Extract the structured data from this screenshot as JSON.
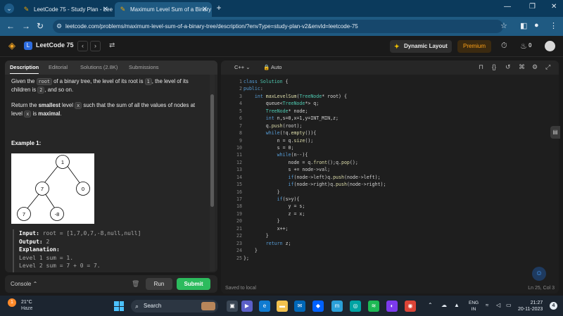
{
  "browser": {
    "tabs": [
      {
        "label": "LeetCode 75 - Study Plan - Lee"
      },
      {
        "label": "Maximum Level Sum of a Binary"
      }
    ],
    "url": "leetcode.com/problems/maximum-level-sum-of-a-binary-tree/description/?envType=study-plan-v2&envId=leetcode-75"
  },
  "header": {
    "plan_title": "LeetCode 75",
    "dynamic_layout": "Dynamic Layout",
    "premium": "Premium",
    "streak": "0"
  },
  "left_tabs": [
    "Description",
    "Editorial",
    "Solutions (2.8K)",
    "Submissions"
  ],
  "description": {
    "p1_a": "Given the ",
    "p1_code1": "root",
    "p1_b": " of a binary tree, the level of its root is ",
    "p1_code2": "1",
    "p1_c": ", the level of its children is ",
    "p1_code3": "2",
    "p1_d": ", and so on.",
    "p2_a": "Return the ",
    "p2_b": "smallest",
    "p2_c": " level ",
    "p2_code": "x",
    "p2_d": " such that the sum of all the values of nodes at level ",
    "p2_code2": "x",
    "p2_e": " is ",
    "p2_f": "maximal",
    "p2_g": "."
  },
  "example": {
    "title": "Example 1:",
    "tree_nodes": [
      "1",
      "7",
      "0",
      "7",
      "-8"
    ],
    "input_label": "Input:",
    "input_value": " root = [1,7,0,7,-8,null,null]",
    "output_label": "Output:",
    "output_value": " 2",
    "explanation_label": "Explanation:",
    "line1": "Level 1 sum = 1.",
    "line2": "Level 2 sum = 7 + 0 = 7."
  },
  "console": {
    "label": "Console",
    "run": "Run",
    "submit": "Submit"
  },
  "editor": {
    "language": "C++",
    "mode": "Auto",
    "status": "Saved to local",
    "cursor": "Ln 25, Col 3",
    "line_numbers": [
      "1",
      "2",
      "3",
      "4",
      "5",
      "6",
      "7",
      "8",
      "9",
      "10",
      "11",
      "12",
      "13",
      "14",
      "15",
      "16",
      "17",
      "18",
      "19",
      "20",
      "21",
      "22",
      "23",
      "24",
      "25"
    ]
  },
  "taskbar": {
    "temperature": "21°C",
    "weather": "Haze",
    "weather_badge": "1",
    "search": "Search",
    "lang1": "ENG",
    "lang2": "IN",
    "time": "21:27",
    "date": "20-11-2023",
    "notifications": "4"
  },
  "colors": {
    "accent_green": "#2cbb5d",
    "premium_orange": "#ffa116",
    "tab_active": "#1f5a82"
  }
}
